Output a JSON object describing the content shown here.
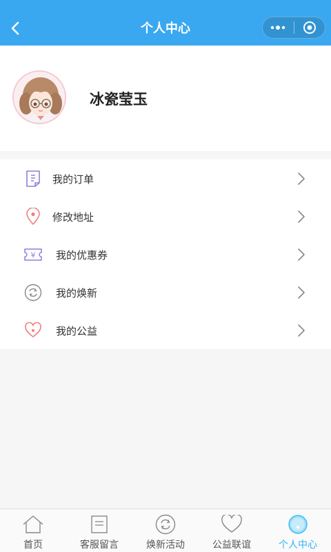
{
  "navbar": {
    "title": "个人中心"
  },
  "profile": {
    "username": "冰瓷莹玉"
  },
  "menu": {
    "items": [
      {
        "label": "我的订单",
        "icon": "order-icon"
      },
      {
        "label": "修改地址",
        "icon": "location-icon"
      },
      {
        "label": "我的优惠券",
        "icon": "coupon-icon"
      },
      {
        "label": "我的焕新",
        "icon": "renew-icon"
      },
      {
        "label": "我的公益",
        "icon": "charity-heart-icon"
      }
    ]
  },
  "tabbar": {
    "active": "个人中心",
    "active_color": "#29b6f6",
    "items": [
      {
        "label": "首页",
        "icon": "home-icon"
      },
      {
        "label": "客服留言",
        "icon": "message-icon"
      },
      {
        "label": "焕新活动",
        "icon": "renew-icon"
      },
      {
        "label": "公益联谊",
        "icon": "heart-icon"
      },
      {
        "label": "个人中心",
        "icon": "user-icon"
      }
    ]
  },
  "colors": {
    "navbar": "#3aa8f0",
    "accent": "#29b6f6"
  }
}
